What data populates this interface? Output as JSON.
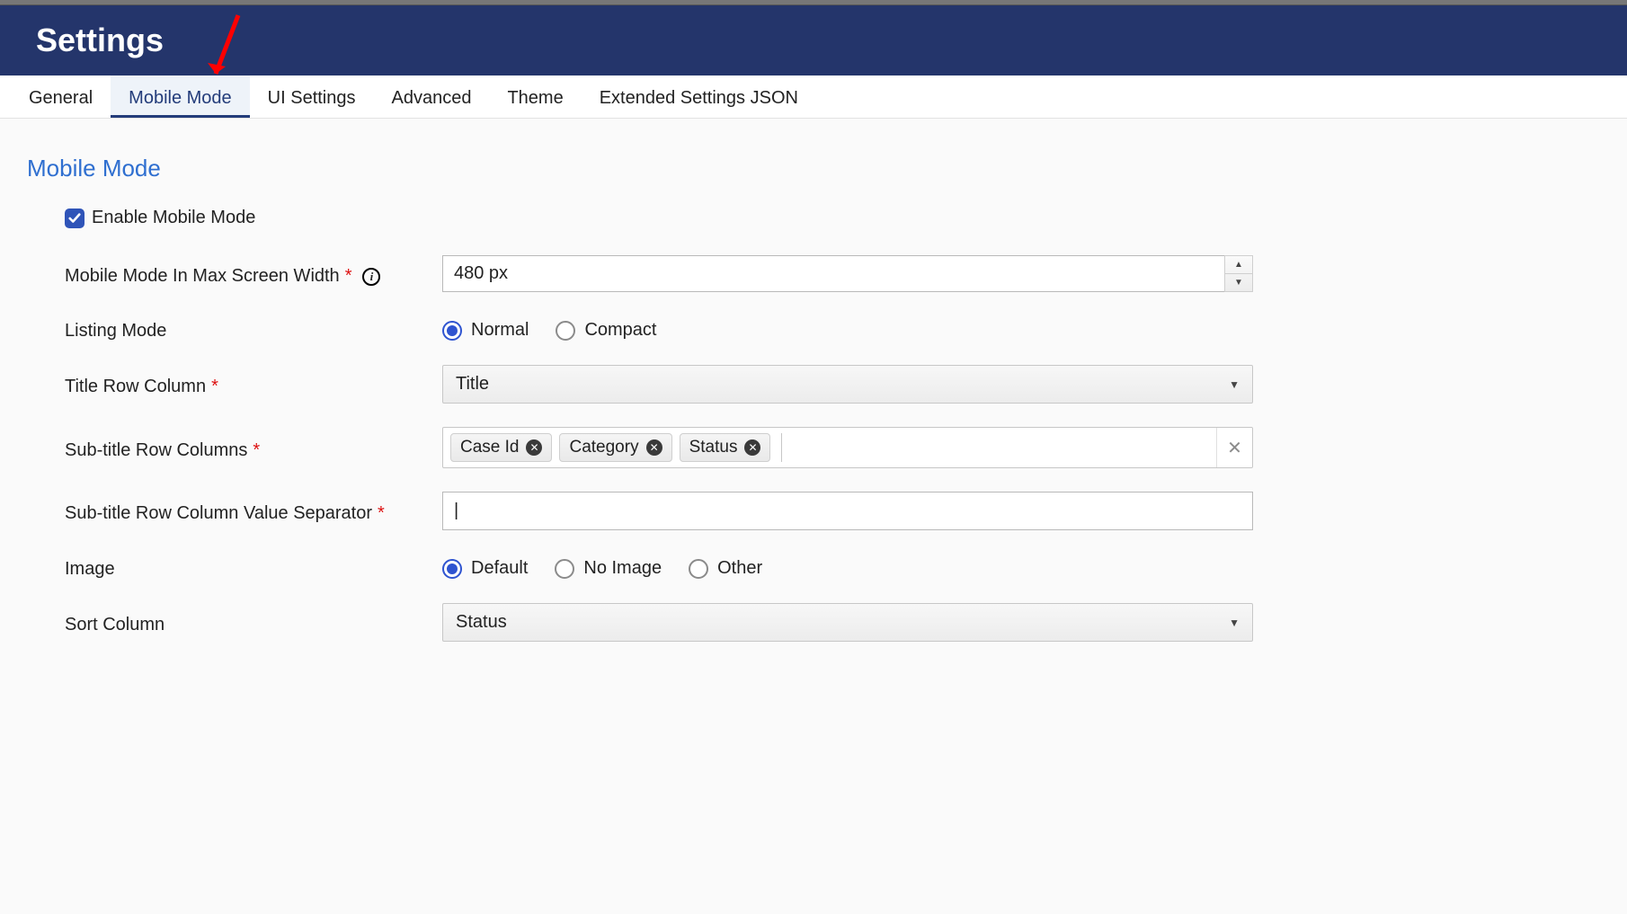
{
  "header": {
    "title": "Settings"
  },
  "tabs": [
    {
      "label": "General"
    },
    {
      "label": "Mobile Mode"
    },
    {
      "label": "UI Settings"
    },
    {
      "label": "Advanced"
    },
    {
      "label": "Theme"
    },
    {
      "label": "Extended Settings JSON"
    }
  ],
  "activeTabIndex": 1,
  "section": {
    "heading": "Mobile Mode",
    "enable": {
      "label": "Enable Mobile Mode",
      "checked": true
    },
    "fields": {
      "maxWidth": {
        "label": "Mobile Mode In Max Screen Width",
        "required": true,
        "info": true,
        "value": "480 px"
      },
      "listingMode": {
        "label": "Listing Mode",
        "options": [
          "Normal",
          "Compact"
        ],
        "selected": "Normal"
      },
      "titleRow": {
        "label": "Title Row Column",
        "required": true,
        "value": "Title"
      },
      "subtitleCols": {
        "label": "Sub-title Row Columns",
        "required": true,
        "chips": [
          "Case Id",
          "Category",
          "Status"
        ]
      },
      "separator": {
        "label": "Sub-title Row Column Value Separator",
        "required": true,
        "value": "|"
      },
      "image": {
        "label": "Image",
        "options": [
          "Default",
          "No Image",
          "Other"
        ],
        "selected": "Default"
      },
      "sortCol": {
        "label": "Sort Column",
        "value": "Status"
      }
    }
  }
}
